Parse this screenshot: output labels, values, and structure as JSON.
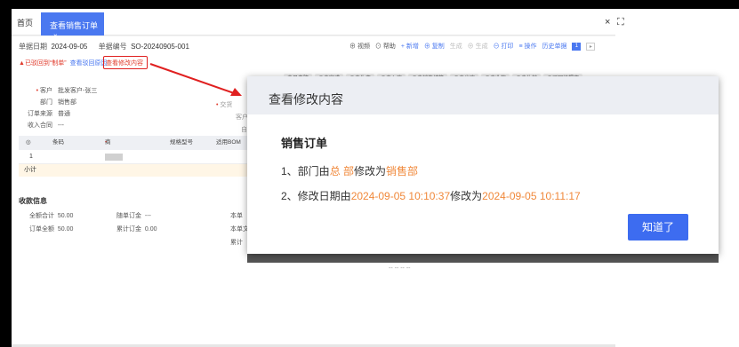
{
  "tabs": {
    "home": "首页",
    "active": "查看销售订单",
    "close": "×"
  },
  "window_controls": {
    "close": "×",
    "expand": "⛶"
  },
  "meta": {
    "date_label": "单据日期",
    "date": "2024-09-05",
    "no_label": "单据编号",
    "no": "SO-20240905-001"
  },
  "toolbar": {
    "video": "⊕ 视频",
    "help": "⊙ 帮助",
    "new": "+ 新增",
    "copy": "⊕ 复制",
    "gen": "生成",
    "save": "⊕ 生成",
    "print": "⊖ 打印",
    "ops": "≡ 操作",
    "history": "历史单据",
    "page": "1"
  },
  "alert": {
    "text": "已驳回到“制单”",
    "reason_link": "查看驳回原因",
    "modify_link": "查看修改内容"
  },
  "statuses": [
    "未日电脑",
    "⊗未完成",
    "⊗未生产",
    "⊗未入库",
    "⊗未销售结算",
    "⊗未出库",
    "⊗未收款",
    "⊗未生效",
    "⊗驳回待提交"
  ],
  "form": {
    "customer_label": "客户",
    "customer": "批发客户-张三",
    "dept_label": "部门",
    "dept": "销售部",
    "source_label": "订单来源",
    "source": "普通",
    "contract_label": "收入合同",
    "contract": "---",
    "delivery_label": "交货",
    "cust2_label": "客户",
    "self_label": "自"
  },
  "table": {
    "headers": [
      "◎",
      "条码",
      "商品",
      "规格型号",
      "适用BOM"
    ],
    "row_no": "1",
    "subtotal": "小计"
  },
  "payment": {
    "title": "收款信息",
    "total_label": "全额合计",
    "total": "50.00",
    "order_amt_label": "订单全额",
    "order_amt": "50.00",
    "deposit_label": "随单订金",
    "deposit": "---",
    "acc_deposit_label": "累计订金",
    "acc_deposit": "0.00",
    "current_label": "本单",
    "current2_label": "本单文",
    "acc_label": "累计",
    "ghost_text": "-- -- -- --"
  },
  "modal": {
    "title": "查看修改内容",
    "heading": "销售订单",
    "line1_prefix": "1、部门由",
    "line1_old": "总 部",
    "line1_mid": "修改为",
    "line1_new": "销售部",
    "line2_prefix": "2、修改日期由",
    "line2_old": "2024-09-05 10:10:37",
    "line2_mid": "修改为",
    "line2_new": "2024-09-05 10:11:17",
    "ok": "知道了"
  },
  "colors": {
    "accent": "#3d6cf0",
    "highlight_red": "#e02020",
    "changed_orange": "#f0883a"
  }
}
